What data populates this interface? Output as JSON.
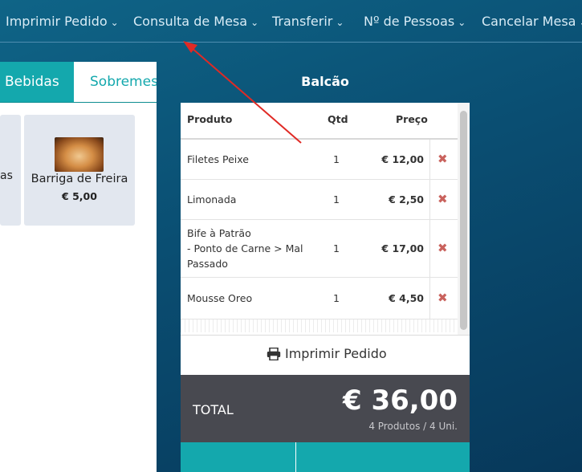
{
  "topnav": {
    "items": [
      {
        "label": "Imprimir Pedido"
      },
      {
        "label": "Consulta de Mesa"
      },
      {
        "label": "Transferir"
      },
      {
        "label": "Nº de Pessoas"
      },
      {
        "label": "Cancelar Mesa"
      }
    ],
    "chevron": "⌄"
  },
  "categories": {
    "tabs": [
      {
        "label": "Bebidas",
        "active": true
      },
      {
        "label": "Sobremesas",
        "active": false
      }
    ]
  },
  "products": [
    {
      "name": "as",
      "partial": true
    },
    {
      "name": "Barriga de Freira",
      "price": "€ 5,00",
      "image": "dessert-photo"
    }
  ],
  "order": {
    "title": "Balcão",
    "columns": {
      "product": "Produto",
      "qty": "Qtd",
      "price": "Preço"
    },
    "items": [
      {
        "lines": [
          "Filetes Peixe"
        ],
        "qty": "1",
        "price": "€ 12,00"
      },
      {
        "lines": [
          "Limonada"
        ],
        "qty": "1",
        "price": "€ 2,50"
      },
      {
        "lines": [
          "Bife à Patrão",
          "- Ponto de Carne > Mal",
          "Passado"
        ],
        "qty": "1",
        "price": "€ 17,00"
      },
      {
        "lines": [
          "Mousse Oreo"
        ],
        "qty": "1",
        "price": "€ 4,50"
      }
    ],
    "remove_icon": "✖",
    "print_label": "Imprimir Pedido",
    "total_label": "TOTAL",
    "total_value": "€ 36,00",
    "total_summary": "4 Produtos / 4 Uni."
  },
  "colors": {
    "accent": "#14a8ad",
    "background": "#0b5275",
    "total_bar": "#484950",
    "remove": "#c9625d",
    "annotation_arrow": "#e02a25"
  }
}
